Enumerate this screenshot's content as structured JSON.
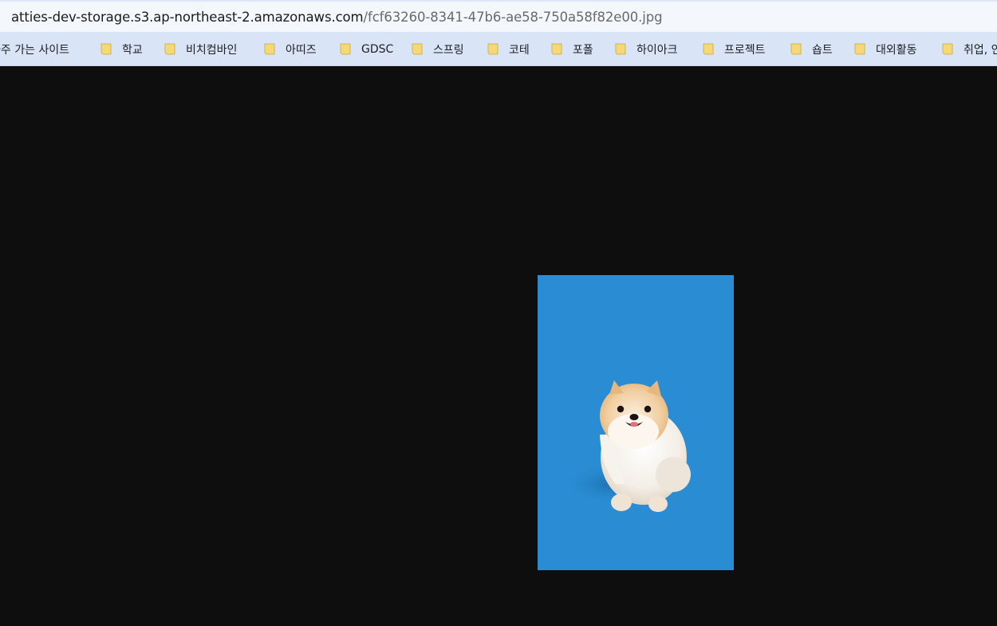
{
  "address_bar": {
    "url_host": "atties-dev-storage.s3.ap-northeast-2.amazonaws.com",
    "url_path": "/fcf63260-8341-47b6-ae58-750a58f82e00.jpg"
  },
  "bookmarks": [
    {
      "label": "자주 가는 사이트",
      "icon": "none"
    },
    {
      "label": "학교",
      "icon": "folder-icon"
    },
    {
      "label": "비치컴바인",
      "icon": "folder-icon"
    },
    {
      "label": "아띠즈",
      "icon": "folder-icon"
    },
    {
      "label": "GDSC",
      "icon": "folder-icon"
    },
    {
      "label": "스프링",
      "icon": "folder-icon"
    },
    {
      "label": "코테",
      "icon": "folder-icon"
    },
    {
      "label": "포폴",
      "icon": "folder-icon"
    },
    {
      "label": "하이아크",
      "icon": "folder-icon"
    },
    {
      "label": "프로젝트",
      "icon": "folder-icon"
    },
    {
      "label": "숍트",
      "icon": "folder-icon"
    },
    {
      "label": "대외활동",
      "icon": "folder-icon"
    },
    {
      "label": "취업, 인",
      "icon": "folder-icon"
    }
  ],
  "colors": {
    "background": "#0e0e0e",
    "photo_background": "#2a8dd4",
    "folder_icon": "#f6d976",
    "bookmarks_bar": "#d9e4f6"
  },
  "image": {
    "subject": "pomeranian-dog-photo"
  }
}
